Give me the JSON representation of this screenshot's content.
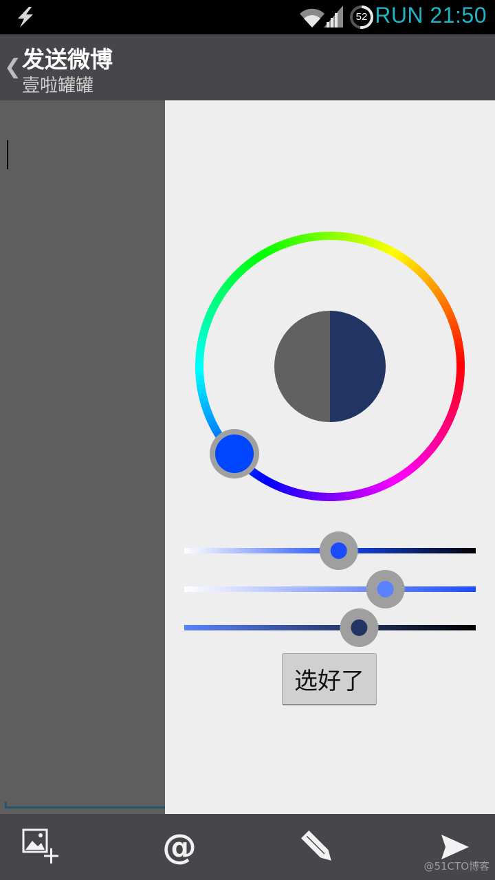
{
  "status_bar": {
    "run_label": "RUN 21:50",
    "battery_level": "52",
    "icons": [
      "lightning-icon",
      "wifi-icon",
      "signal-icon",
      "battery-ring-icon"
    ]
  },
  "action_bar": {
    "title": "发送微博",
    "subtitle": "壹啦罐罐",
    "back_glyph": "❮"
  },
  "color_picker": {
    "selected_color": "#223463",
    "previous_color": "#616161",
    "hue_color": "#0046ff",
    "sliders": [
      {
        "name": "saturation",
        "level": 0.53
      },
      {
        "name": "value",
        "level": 0.69
      },
      {
        "name": "opacity",
        "level": 0.6
      }
    ],
    "confirm_label": "选好了"
  },
  "bottom_bar": {
    "at_glyph": "@",
    "icons": [
      "add-image-icon",
      "at-icon",
      "pencil-icon",
      "send-icon"
    ]
  },
  "watermark": "@51CTO博客"
}
